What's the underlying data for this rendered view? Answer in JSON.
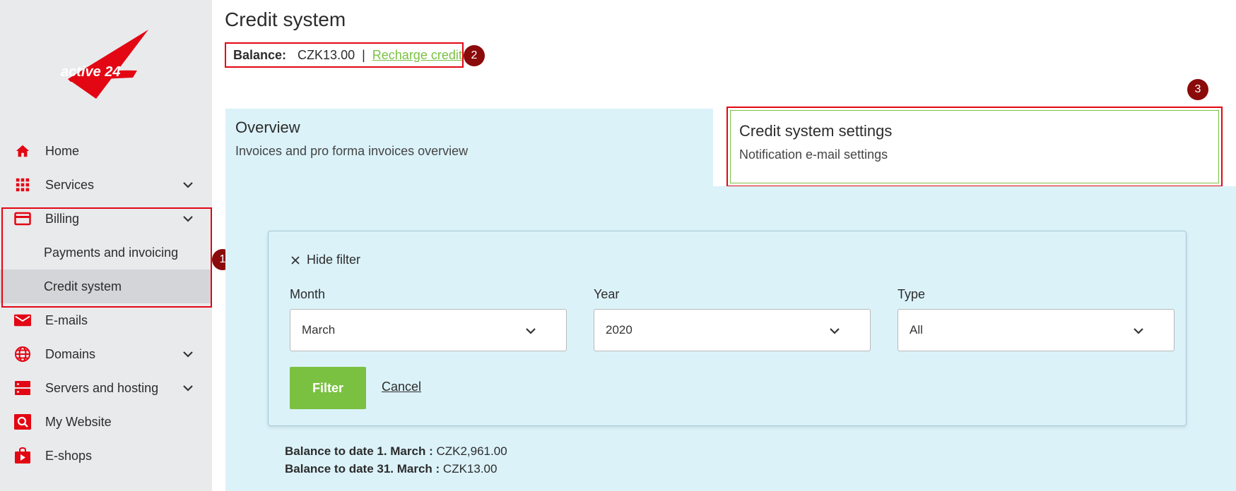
{
  "logo": {
    "text": "active 24"
  },
  "sidebar": {
    "items": [
      {
        "label": "Home",
        "icon": "home-icon"
      },
      {
        "label": "Services",
        "icon": "grid-icon"
      },
      {
        "label": "Billing",
        "icon": "credit-card-icon"
      },
      {
        "label": "E-mails",
        "icon": "envelope-icon"
      },
      {
        "label": "Domains",
        "icon": "globe-icon"
      },
      {
        "label": "Servers and hosting",
        "icon": "server-icon"
      },
      {
        "label": "My Website",
        "icon": "website-search-icon"
      },
      {
        "label": "E-shops",
        "icon": "shop-bag-icon"
      }
    ],
    "billing_sub": [
      {
        "label": "Payments and invoicing"
      },
      {
        "label": "Credit system"
      }
    ]
  },
  "page": {
    "title": "Credit system"
  },
  "balance": {
    "label": "Balance:",
    "value": "CZK13.00",
    "separator": "|",
    "recharge_link": "Recharge credit"
  },
  "badges": {
    "one": "1",
    "two": "2",
    "three": "3"
  },
  "tabs": {
    "overview": {
      "title": "Overview",
      "subtitle": "Invoices and pro forma invoices overview"
    },
    "settings": {
      "title": "Credit system settings",
      "subtitle": "Notification e-mail settings"
    }
  },
  "filter": {
    "hide_label": "Hide filter",
    "month": {
      "label": "Month",
      "value": "March"
    },
    "year": {
      "label": "Year",
      "value": "2020"
    },
    "type": {
      "label": "Type",
      "value": "All"
    },
    "filter_button": "Filter",
    "cancel_link": "Cancel"
  },
  "balances": {
    "start_label": "Balance to date 1. March :",
    "start_value": "CZK2,961.00",
    "end_label": "Balance to date 31. March :",
    "end_value": "CZK13.00"
  },
  "colors": {
    "brand_red": "#e30613",
    "accent_green": "#7ac142",
    "panel_blue": "#dbf2f9",
    "badge_red": "#8b0a0a"
  }
}
